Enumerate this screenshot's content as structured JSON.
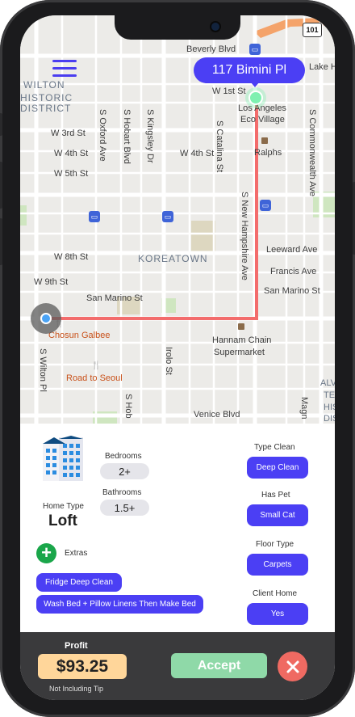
{
  "map": {
    "area_labels": [
      "WILTON",
      "HISTORIC",
      "DISTRICT",
      "KOREATOWN"
    ],
    "streets_h": [
      "Beverly Blvd",
      "W 1st St",
      "W 3rd St",
      "W 4th St",
      "W 5th St",
      "W 8th St",
      "W 9th St",
      "San Marino St",
      "Leeward Ave",
      "Francis Ave",
      "San Marino St",
      "Venice Blvd"
    ],
    "streets_v": [
      "S Oxford Ave",
      "S Hobart Blvd",
      "S Kingsley Dr",
      "S Catalina St",
      "S New Hampshire Ave",
      "S Commonwealth Ave",
      "S Wilton Pl",
      "Irolo St",
      "S Hob",
      "Magn"
    ],
    "places": [
      "Los Angeles",
      "Eco Village",
      "Ralphs",
      "Lake H",
      "Hannam Chain",
      "Supermarket",
      "Chosun Galbee",
      "Road to Seoul",
      "ALV",
      "TE",
      "HIS",
      "DIS"
    ],
    "highway_badge": "101",
    "destination": "117 Bimini Pl",
    "route_color": "#f36c6c"
  },
  "job": {
    "bedrooms_label": "Bedrooms",
    "bedrooms_value": "2+",
    "bathrooms_label": "Bathrooms",
    "bathrooms_value": "1.5+",
    "home_type_label": "Home Type",
    "home_type_value": "Loft",
    "extras_label": "Extras",
    "extras": [
      "Fridge Deep Clean",
      "Wash Bed + Pillow Linens Then Make Bed"
    ],
    "type_clean_label": "Type Clean",
    "type_clean_value": "Deep Clean",
    "has_pet_label": "Has Pet",
    "has_pet_value": "Small Cat",
    "floor_type_label": "Floor Type",
    "floor_type_value": "Carpets",
    "client_home_label": "Client Home",
    "client_home_value": "Yes"
  },
  "footer": {
    "profit_label": "Profit",
    "profit_value": "$93.25",
    "tip_note": "Not Including Tip",
    "accept_label": "Accept"
  },
  "colors": {
    "accent": "#4b3ff4",
    "accept": "#8fd9a8",
    "decline": "#ef6a62",
    "profit_bg": "#ffd69a"
  }
}
